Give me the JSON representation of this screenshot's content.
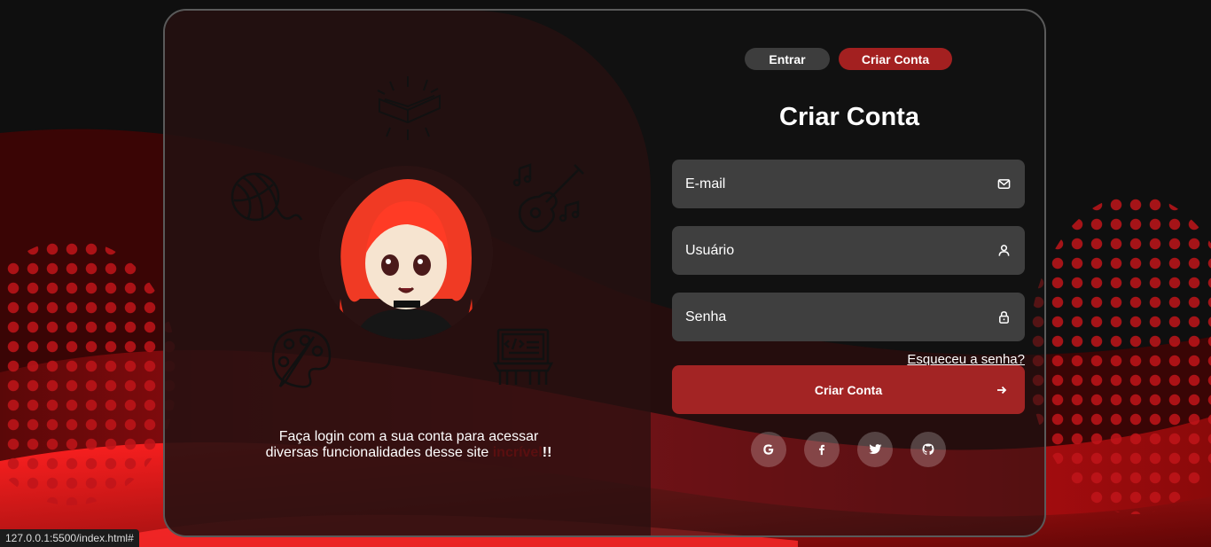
{
  "tabs": {
    "login_label": "Entrar",
    "register_label": "Criar Conta"
  },
  "form": {
    "title": "Criar Conta",
    "email_placeholder": "E-mail",
    "username_placeholder": "Usuário",
    "password_placeholder": "Senha",
    "forgot_label": "Esqueceu a senha?",
    "submit_label": "Criar Conta"
  },
  "left": {
    "text_main": "Faça login com a sua conta para acessar diversas funcionalidades desse site",
    "text_highlight": "incrível",
    "text_end": "!!"
  },
  "socials": [
    "google-icon",
    "facebook-icon",
    "twitter-icon",
    "github-icon"
  ],
  "status_bar": {
    "url": "127.0.0.1:5500/index.html#"
  },
  "colors": {
    "accent": "#a32424",
    "tab_inactive": "#3d3d3d",
    "field_bg": "#3f3f3f",
    "background": "#0f0f0f"
  }
}
